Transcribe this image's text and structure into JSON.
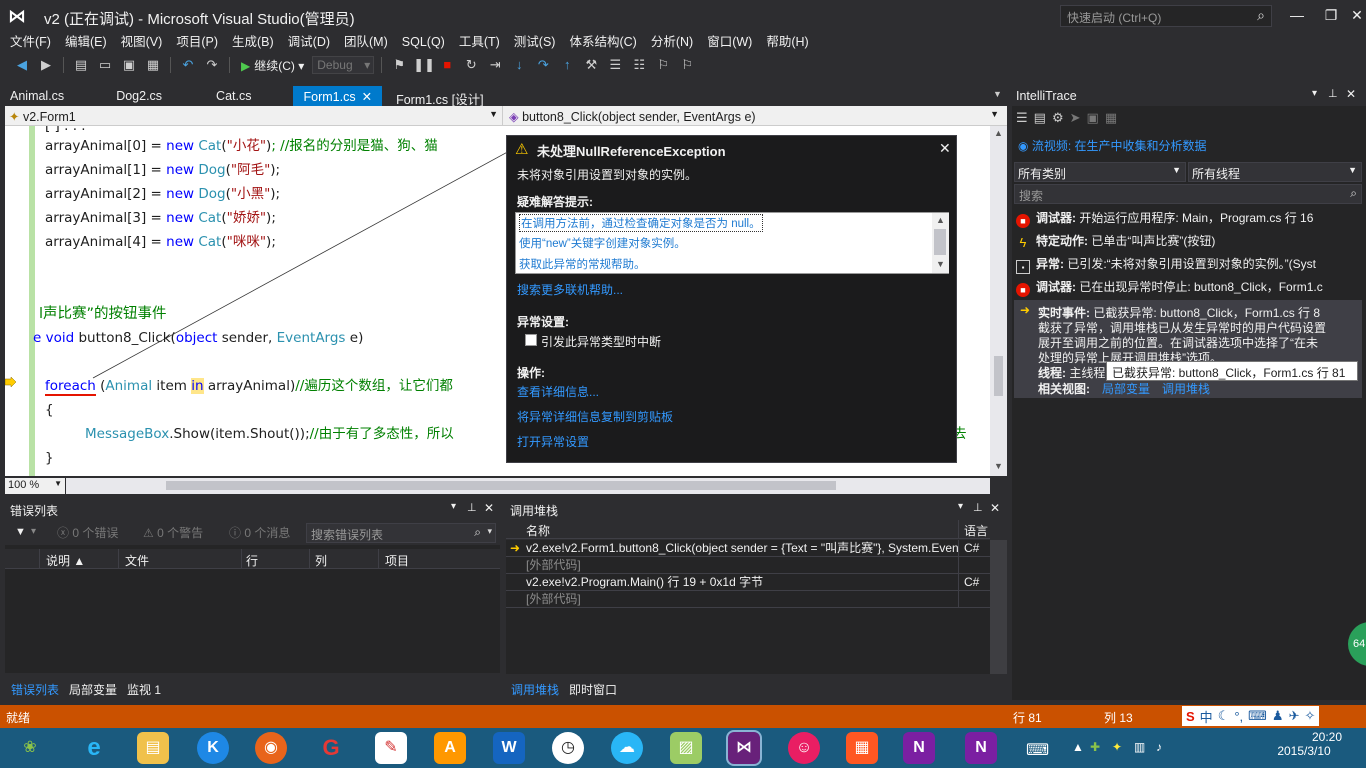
{
  "window": {
    "title": "v2 (正在调试) - Microsoft Visual Studio(管理员)",
    "quick_launch_placeholder": "快速启动 (Ctrl+Q)"
  },
  "menu": [
    "文件(F)",
    "编辑(E)",
    "视图(V)",
    "项目(P)",
    "生成(B)",
    "调试(D)",
    "团队(M)",
    "SQL(Q)",
    "工具(T)",
    "测试(S)",
    "体系结构(C)",
    "分析(N)",
    "窗口(W)",
    "帮助(H)"
  ],
  "toolbar": {
    "continue_label": "继续(C)",
    "config_value": "Debug"
  },
  "doc_tabs": [
    "Animal.cs",
    "Dog2.cs",
    "Cat.cs",
    "Form1.cs",
    "Form1.cs [设计]"
  ],
  "nav": {
    "class_label": "v2.Form1",
    "member_label": "button8_Click(object sender, EventArgs e)"
  },
  "code": {
    "line0_partial": "[ ]  . . .",
    "lines": [
      {
        "prefix": "arrayAnimal[0]  =  ",
        "kw": "new",
        "type": "Cat",
        "str": "\"小花\"",
        "comment": "; //报名的分别是猫、狗、猫"
      },
      {
        "prefix": "arrayAnimal[1]  =  ",
        "kw": "new",
        "type": "Dog",
        "str": "\"阿毛\"",
        "comment": ");"
      },
      {
        "prefix": "arrayAnimal[2]  =  ",
        "kw": "new",
        "type": "Dog",
        "str": "\"小黑\"",
        "comment": ");"
      },
      {
        "prefix": "arrayAnimal[3]  =  ",
        "kw": "new",
        "type": "Cat",
        "str": "\"娇娇\"",
        "comment": ");"
      },
      {
        "prefix": "arrayAnimal[4]  =  ",
        "kw": "new",
        "type": "Cat",
        "str": "\"咪咪\"",
        "comment": ");"
      }
    ],
    "section_comment": "l声比赛”的按钮事件",
    "method_e": "e",
    "method_kw": "void",
    "method_name": "button8_Click",
    "method_p1_type": "object",
    "method_p1": "sender,",
    "method_p2_type": "EventArgs",
    "method_p2": "e",
    "foreach_kw": "foreach",
    "foreach_type": "Animal",
    "foreach_var": "item",
    "foreach_in": "in",
    "foreach_rest": "arrayAnimal)",
    "foreach_comment": "//遍历这个数组，让它们都",
    "brace_open": "{",
    "brace_close": "}",
    "msgbox_type": "MessageBox",
    "msgbox_call": ".Show(item.Shout());",
    "msgbox_comment": "//由于有了多态性，所以",
    "msgbox_tail": "去"
  },
  "exception": {
    "title": "未处理NullReferenceException",
    "message": "未将对象引用设置到对象的实例。",
    "tips_heading": "疑难解答提示:",
    "tips": [
      "在调用方法前，通过检查确定对象是否为 null。",
      "使用“new”关键字创建对象实例。",
      "获取此异常的常规帮助。"
    ],
    "more_help": "搜索更多联机帮助...",
    "settings_heading": "异常设置:",
    "break_label": "引发此异常类型时中断",
    "actions_heading": "操作:",
    "actions": [
      "查看详细信息...",
      "将异常详细信息复制到剪贴板",
      "打开异常设置"
    ]
  },
  "zoom": "100 %",
  "error_list": {
    "title": "错误列表",
    "errors": "0 个错误",
    "warnings": "0 个警告",
    "messages": "0 个消息",
    "search_placeholder": "搜索错误列表",
    "columns": [
      "说明",
      "文件",
      "行",
      "列",
      "项目"
    ]
  },
  "call_stack": {
    "title": "调用堆栈",
    "columns": [
      "名称",
      "语言"
    ],
    "rows": [
      {
        "name": "v2.exe!v2.Form1.button8_Click(object sender = {Text = \"叫声比赛\"}, System.Event",
        "lang": "C#",
        "current": true
      },
      {
        "name": "[外部代码]",
        "lang": "",
        "current": false
      },
      {
        "name": "v2.exe!v2.Program.Main() 行 19 + 0x1d 字节",
        "lang": "C#",
        "current": false
      },
      {
        "name": "[外部代码]",
        "lang": "",
        "current": false
      }
    ]
  },
  "bottom_tabs_left": [
    "错误列表",
    "局部变量",
    "监视 1"
  ],
  "bottom_tabs_right": [
    "调用堆栈",
    "即时窗口"
  ],
  "intellitrace": {
    "title": "IntelliTrace",
    "stream_link": "流视频: 在生产中收集和分析数据",
    "category": "所有类别",
    "thread": "所有线程",
    "search_placeholder": "搜索",
    "events": [
      {
        "label": "调试器:",
        "text": "开始运行应用程序: Main，Program.cs 行 16"
      },
      {
        "label": "特定动作:",
        "text": "已单击“叫声比赛”(按钮)"
      },
      {
        "label": "异常:",
        "text": "已引发:“未将对象引用设置到对象的实例。”(Syst"
      },
      {
        "label": "调试器:",
        "text": "已在出现异常时停止: button8_Click，Form1.c"
      }
    ],
    "detail_label": "实时事件:",
    "detail_lines": [
      "已截获异常: button8_Click，Form1.cs 行 8",
      "截获了异常，调用堆栈已从发生异常时的用户代码设置",
      "展开至调用之前的位置。在调试器选项中选择了“在未",
      "处理的异常上展开调用堆栈”选项。"
    ],
    "thread_label": "线程:",
    "thread_value": "主线程",
    "related_label": "相关视图:",
    "related_links": [
      "局部变量",
      "调用堆栈"
    ],
    "tooltip": "已截获异常: button8_Click，Form1.cs 行 81"
  },
  "status": {
    "ready": "就绪",
    "line": "行 81",
    "col": "列 13"
  },
  "taskbar": {
    "time": "20:20",
    "date": "2015/3/10",
    "badge": "64"
  }
}
